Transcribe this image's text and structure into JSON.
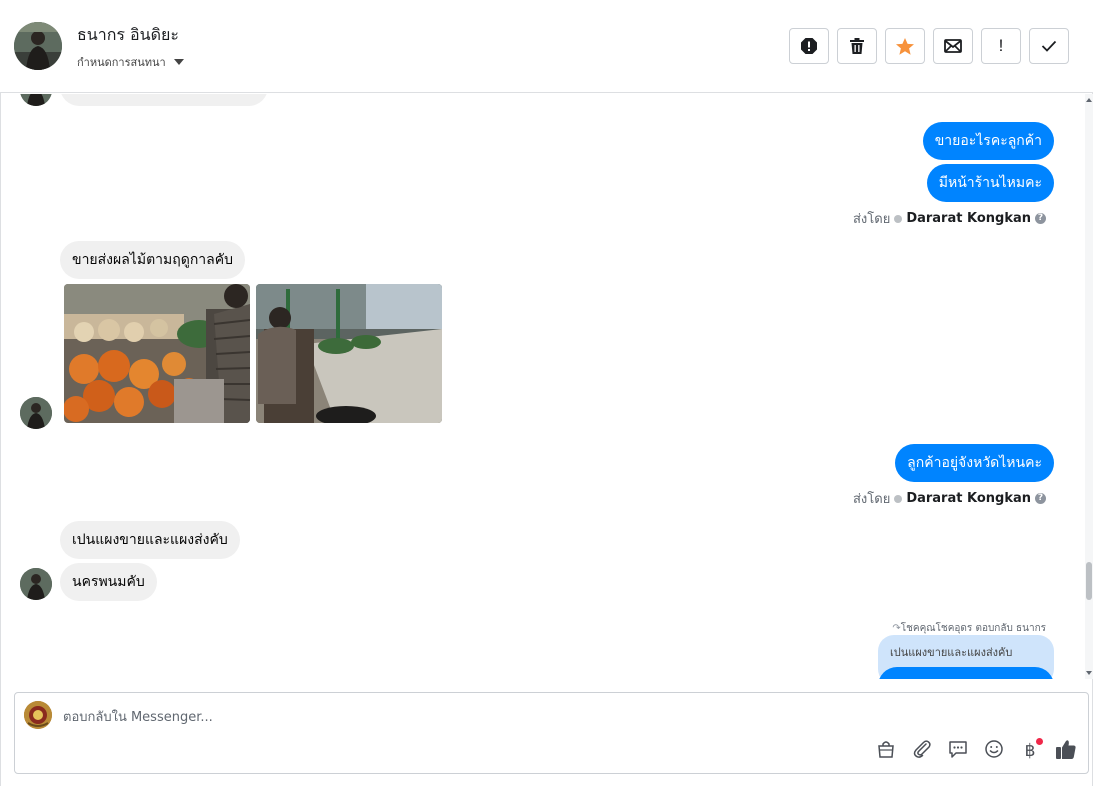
{
  "header": {
    "contact_name": "ธนากร อินดิยะ",
    "conversation_settings": "กำหนดการสนทนา"
  },
  "toolbar": {
    "buttons": [
      "alert-icon",
      "trash-icon",
      "star-icon",
      "envelope-icon",
      "exclamation-icon",
      "check-icon"
    ],
    "exclamation_label": "!"
  },
  "messages": {
    "out1": "ขายอะไรคะลูกค้า",
    "out2": "มีหน้าร้านไหมคะ",
    "sent_by_label": "ส่งโดย",
    "sent_by_name": "Dararat Kongkan",
    "in1": "ขายส่งผลไม้ตามฤดูกาลคับ",
    "out3": "ลูกค้าอยู่จังหวัดไหนคะ",
    "in2": "เปนแผงขายและแผงส่งคับ",
    "in3": "นครพนมคับ",
    "reply_note": "โชคคุณโชคอุดร ตอบกลับ ธนากร",
    "quoted_text": "เปนแผงขายและแผงส่งคับ"
  },
  "composer": {
    "placeholder": "ตอบกลับใน Messenger...",
    "baht_symbol": "฿"
  },
  "colors": {
    "accent": "#0084ff",
    "incoming_bubble": "#f0f0f0",
    "quoted_bubble": "#cfe4fb",
    "notification_dot": "#f02849"
  }
}
